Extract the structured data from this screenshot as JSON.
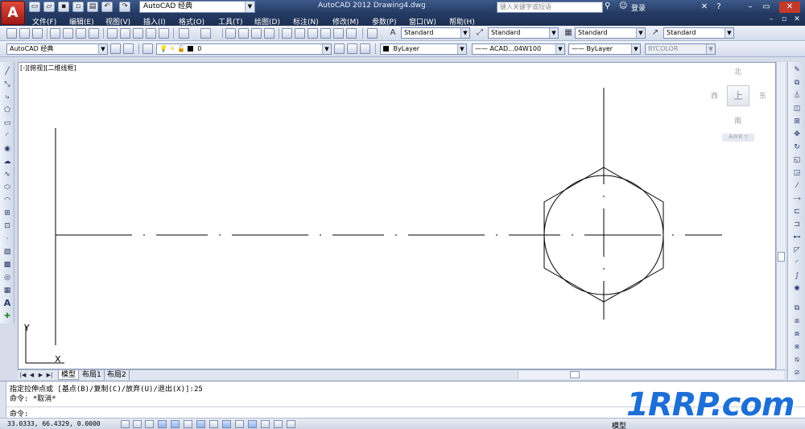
{
  "titlebar": {
    "workspace": "AutoCAD 经典",
    "title": "AutoCAD 2012    Drawing4.dwg",
    "search_placeholder": "键入关键字或短语",
    "login": "登录"
  },
  "menu": [
    "文件(F)",
    "编辑(E)",
    "视图(V)",
    "插入(I)",
    "格式(O)",
    "工具(T)",
    "绘图(D)",
    "标注(N)",
    "修改(M)",
    "参数(P)",
    "窗口(W)",
    "帮助(H)"
  ],
  "styles": {
    "text_style": "Standard",
    "dim_style": "Standard",
    "table_style": "Standard",
    "mleader_style": "Standard"
  },
  "toolbar2": {
    "workspace": "AutoCAD 经典",
    "layer": "0",
    "color": "ByLayer",
    "linetype": "ACAD...04W100",
    "lineweight": "ByLayer",
    "plot_style": "BYCOLOR"
  },
  "viewport": {
    "label": "[-][俯视][二维线框]"
  },
  "viewcube": {
    "north": "北",
    "south": "南",
    "east": "东",
    "west": "西",
    "top": "上",
    "wcs": "未命名 ▽"
  },
  "ucs": {
    "x": "X",
    "y": "Y"
  },
  "tabs": [
    "模型",
    "布局1",
    "布局2"
  ],
  "command": {
    "line1": "指定拉伸点或 [基点(B)/复制(C)/放弃(U)/退出(X)]:25",
    "line2": "命令: *取消*",
    "prompt": "命令:"
  },
  "status": {
    "coords": "33.0333,  66.4329, 0.0000",
    "model": "模型"
  },
  "watermark": {
    "text": "1RRP.com"
  },
  "colors": {
    "title_bar": "#2b4573",
    "canvas": "#ffffff",
    "logo": "#c8302a"
  }
}
